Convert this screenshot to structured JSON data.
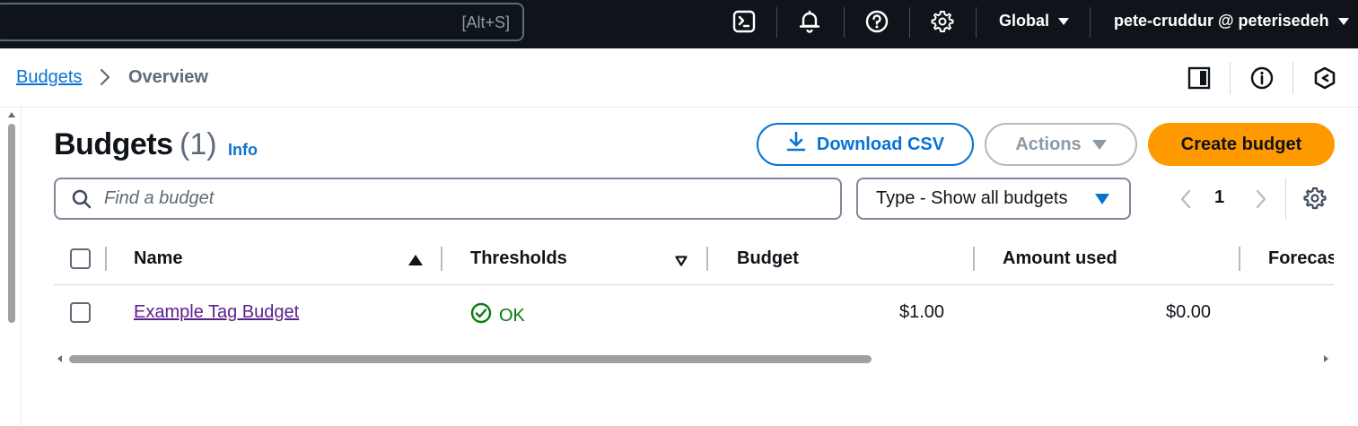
{
  "topnav": {
    "search_shortcut": "[Alt+S]",
    "region": "Global",
    "account": "pete-cruddur @ peterisedeh",
    "icons": [
      "cloudshell-icon",
      "bell-icon",
      "help-icon",
      "settings-icon"
    ]
  },
  "breadcrumb": {
    "root": "Budgets",
    "current": "Overview"
  },
  "utility_icons": [
    "panel-toggle-icon",
    "info-circle-icon",
    "hexagon-icon"
  ],
  "header": {
    "title": "Budgets",
    "count": "(1)",
    "info": "Info",
    "download_label": "Download CSV",
    "actions_label": "Actions",
    "create_label": "Create budget"
  },
  "filters": {
    "search_placeholder": "Find a budget",
    "type_select": "Type - Show all budgets",
    "page": "1"
  },
  "table": {
    "columns": [
      "Name",
      "Thresholds",
      "Budget",
      "Amount used",
      "Forecas"
    ],
    "rows": [
      {
        "name": "Example Tag Budget",
        "threshold": "OK",
        "budget": "$1.00",
        "amount_used": "$0.00",
        "forecast": ""
      }
    ]
  },
  "colors": {
    "nav_bg": "#0f141a",
    "link_blue": "#0972d3",
    "primary_orange": "#ff9900",
    "ok_green": "#037f0c",
    "visited_purple": "#5c1f8b"
  }
}
